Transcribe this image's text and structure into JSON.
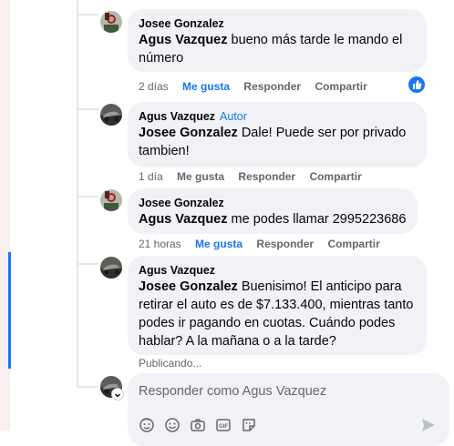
{
  "comments": [
    {
      "author": "Josee Gonzalez",
      "author_tag": "",
      "mention": "Agus Vazquez",
      "text": " bueno más tarde le mando el número",
      "time": "2 días",
      "like": "Me gusta",
      "like_active": true,
      "reply": "Responder",
      "share": "Compartir",
      "reactions": "like-reaction"
    },
    {
      "author": "Agus Vazquez",
      "author_tag": "Autor",
      "mention": "Josee Gonzalez",
      "text": " Dale! Puede ser por privado tambien!",
      "time": "1 día",
      "like": "Me gusta",
      "like_active": false,
      "reply": "Responder",
      "share": "Compartir"
    },
    {
      "author": "Josee Gonzalez",
      "author_tag": "",
      "mention": "Agus Vazquez",
      "text": " me podes llamar 2995223686",
      "time": "21 horas",
      "like": "Me gusta",
      "like_active": true,
      "reply": "Responder",
      "share": "Compartir"
    },
    {
      "author": "Agus Vazquez",
      "author_tag": "",
      "mention": "Josee Gonzalez",
      "text": " Buenisimo! El anticipo para retirar el auto es de $7.133.400, mientras tanto podes ir pagando en cuotas. Cuándo podes hablar? A la mañana o a la tarde?",
      "status": "Publicando..."
    }
  ],
  "composer": {
    "placeholder": "Responder como Agus Vazquez",
    "tools": [
      "avatar-sticker-icon",
      "emoji-icon",
      "camera-icon",
      "gif-icon",
      "sticker-icon"
    ],
    "send": "send-icon"
  },
  "colors": {
    "accent": "#1877f2",
    "bubble": "#f0f2f5",
    "meta": "#65676b"
  }
}
